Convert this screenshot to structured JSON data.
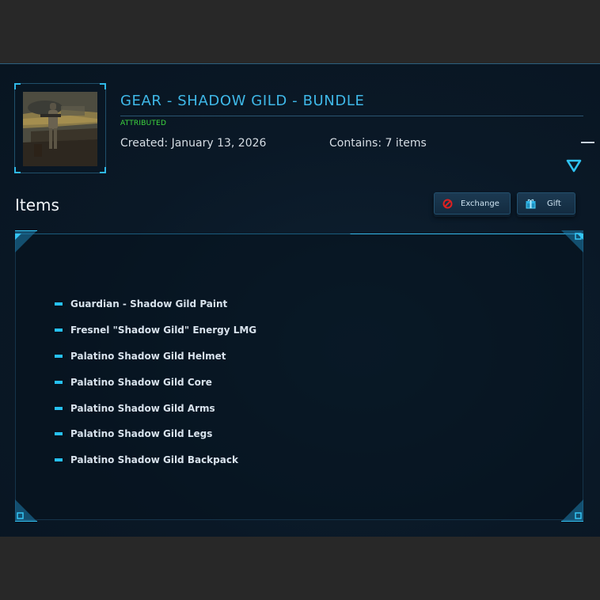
{
  "bundle": {
    "title": "GEAR - SHADOW GILD - BUNDLE",
    "status": "ATTRIBUTED",
    "created": "Created: January 13, 2026",
    "contains": "Contains: 7 items"
  },
  "items_section": {
    "heading": "Items",
    "exchange_label": "Exchange",
    "gift_label": "Gift",
    "items": [
      "Guardian - Shadow Gild Paint",
      "Fresnel \"Shadow Gild\" Energy LMG",
      "Palatino Shadow Gild Helmet",
      "Palatino Shadow Gild Core",
      "Palatino Shadow Gild Arms",
      "Palatino Shadow Gild Legs",
      "Palatino Shadow Gild Backpack"
    ]
  },
  "icons": {
    "exchange": "exchange-icon",
    "gift": "gift-icon",
    "expand": "chevron-down-icon",
    "collapse": "minus-icon"
  },
  "colors": {
    "accent": "#3fb8e8",
    "status_green": "#3ed63e",
    "bullet": "#26c1f2",
    "exchange_red": "#e02020"
  }
}
